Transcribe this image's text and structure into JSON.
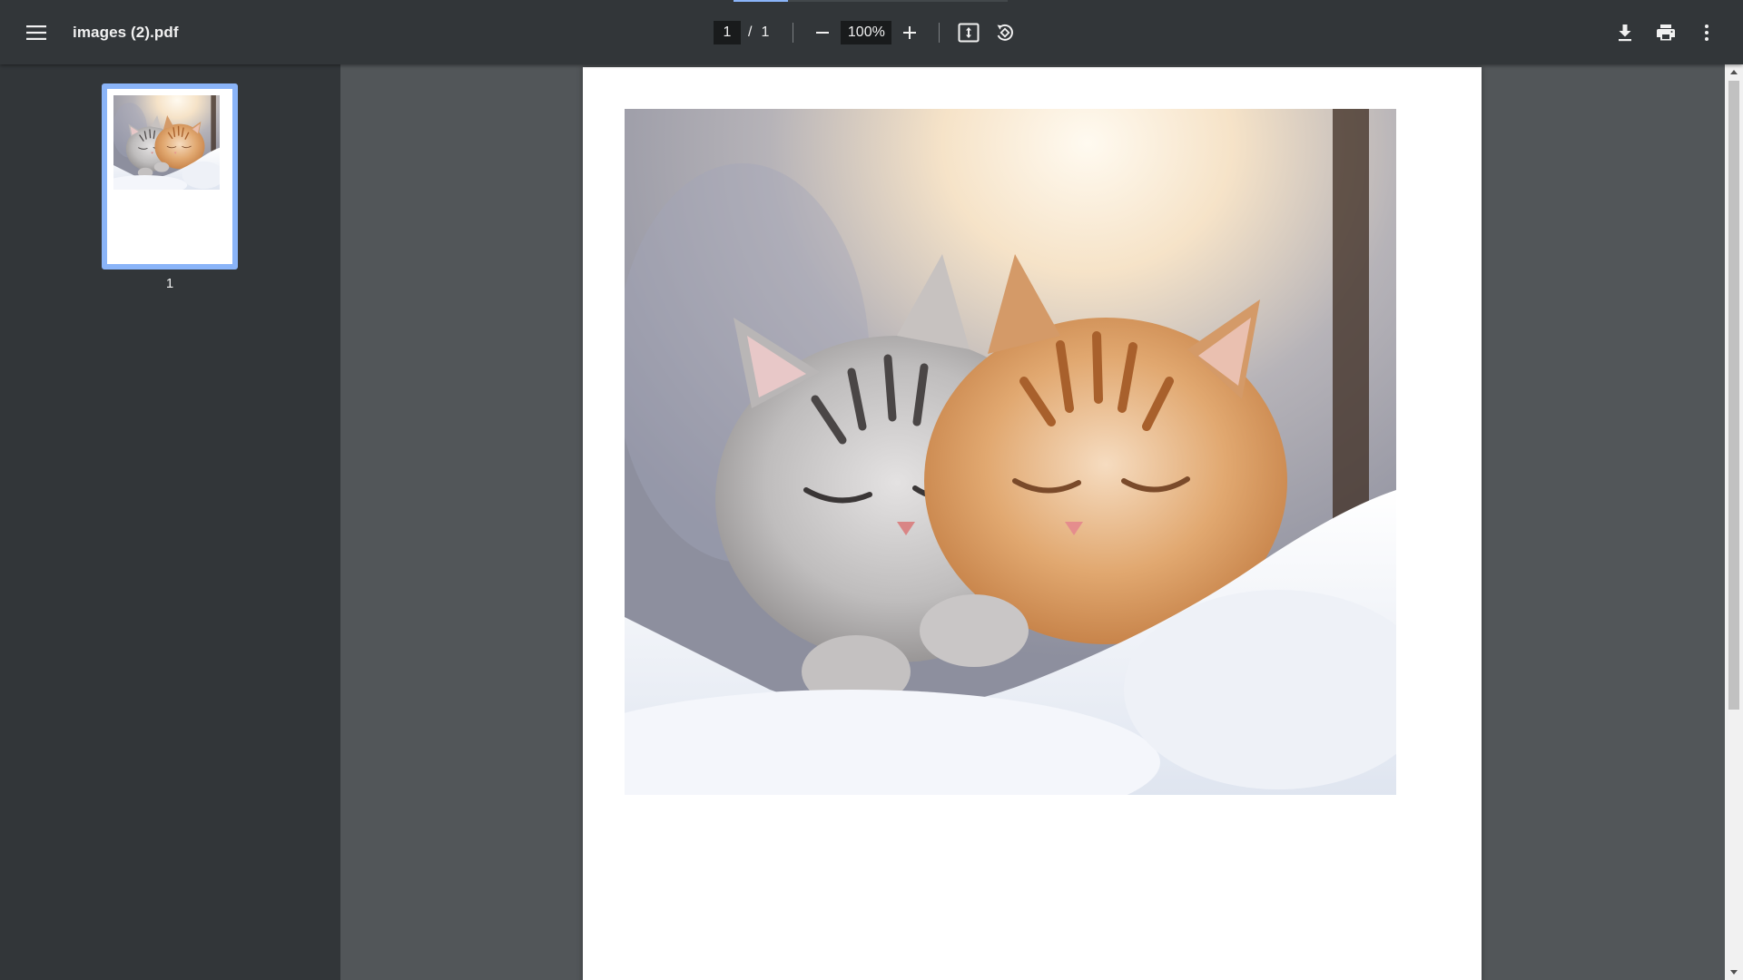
{
  "toolbar": {
    "menu_icon": "hamburger-menu-icon",
    "title": "images (2).pdf",
    "page_current": "1",
    "page_separator": "/",
    "page_total": "1",
    "zoom": "100%",
    "zoom_out_icon": "minus-icon",
    "zoom_in_icon": "plus-icon",
    "fit_icon": "fit-to-page-icon",
    "rotate_icon": "rotate-counterclockwise-icon",
    "download_icon": "download-icon",
    "print_icon": "print-icon",
    "more_icon": "more-vertical-icon",
    "load_progress": 0.2
  },
  "sidebar": {
    "thumbnails": [
      {
        "label": "1",
        "selected": true
      }
    ]
  },
  "document": {
    "image": "two-sleeping-kittens-in-snow"
  },
  "colors": {
    "toolbar_bg": "#323639",
    "viewer_bg": "#525659",
    "accent": "#8ab4f8",
    "input_bg": "#191b1c"
  }
}
